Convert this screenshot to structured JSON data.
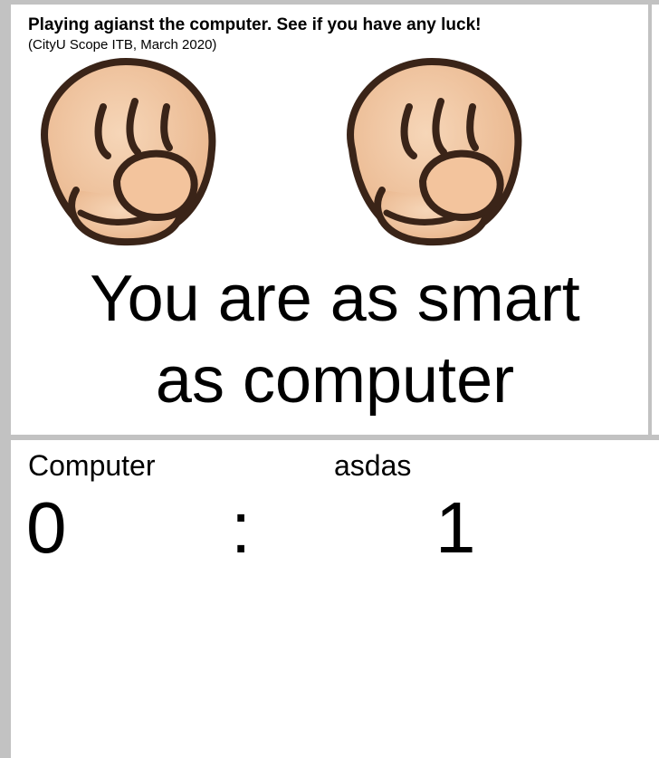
{
  "header": {
    "title": "Playing agianst the computer. See if you have any luck!",
    "subtitle": "(CityU Scope ITB, March 2020)"
  },
  "hands": {
    "computer": "rock-fist-icon",
    "player": "rock-fist-icon"
  },
  "result": {
    "line1": "You are as smart",
    "line2": "as computer"
  },
  "scoreboard": {
    "computer_name": "Computer",
    "player_name": "asdas",
    "computer_score": "0",
    "separator": ":",
    "player_score": "1"
  },
  "colors": {
    "border": "#c2c2c2",
    "skin": "#f2c9a4",
    "outline": "#3a2418"
  }
}
